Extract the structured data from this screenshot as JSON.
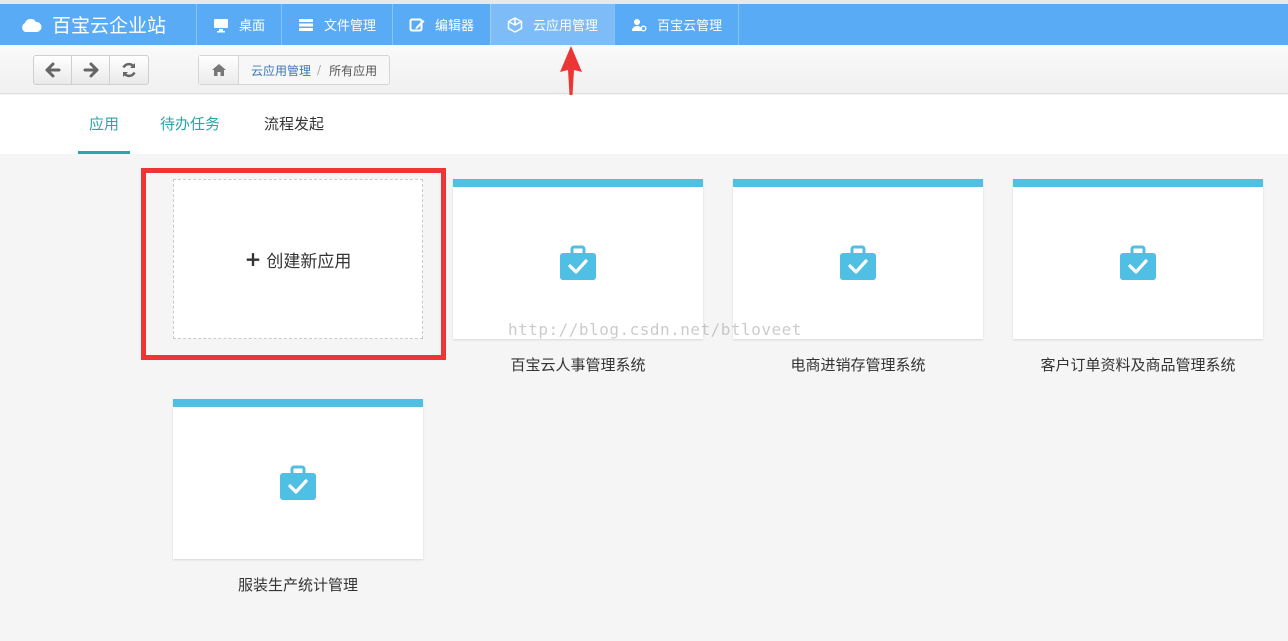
{
  "brand": {
    "title": "百宝云企业站"
  },
  "nav": [
    {
      "label": "桌面",
      "icon": "monitor-icon"
    },
    {
      "label": "文件管理",
      "icon": "list-icon"
    },
    {
      "label": "编辑器",
      "icon": "edit-icon"
    },
    {
      "label": "云应用管理",
      "icon": "cube-icon",
      "active": true
    },
    {
      "label": "百宝云管理",
      "icon": "user-gear-icon"
    }
  ],
  "toolbar": {
    "back_icon": "arrow-left-icon",
    "forward_icon": "arrow-right-icon",
    "refresh_icon": "refresh-icon"
  },
  "breadcrumb": {
    "home_icon": "home-icon",
    "link": "云应用管理",
    "separator": "/",
    "current": "所有应用"
  },
  "tabs": [
    {
      "label": "应用",
      "active": true
    },
    {
      "label": "待办任务"
    },
    {
      "label": "流程发起"
    }
  ],
  "create_card": {
    "plus": "+",
    "label": "创建新应用"
  },
  "apps": [
    {
      "name": "百宝云人事管理系统",
      "icon": "briefcase-check-icon"
    },
    {
      "name": "电商进销存管理系统",
      "icon": "briefcase-check-icon"
    },
    {
      "name": "客户订单资料及商品管理系统",
      "icon": "briefcase-check-icon"
    },
    {
      "name": "服装生产统计管理",
      "icon": "briefcase-check-icon"
    }
  ],
  "watermark": "http://blog.csdn.net/btloveet",
  "colors": {
    "nav_bg": "#5aabf5",
    "accent_teal": "#2aa5a8",
    "card_top": "#4fbfe3",
    "highlight_red": "#ee3536"
  }
}
